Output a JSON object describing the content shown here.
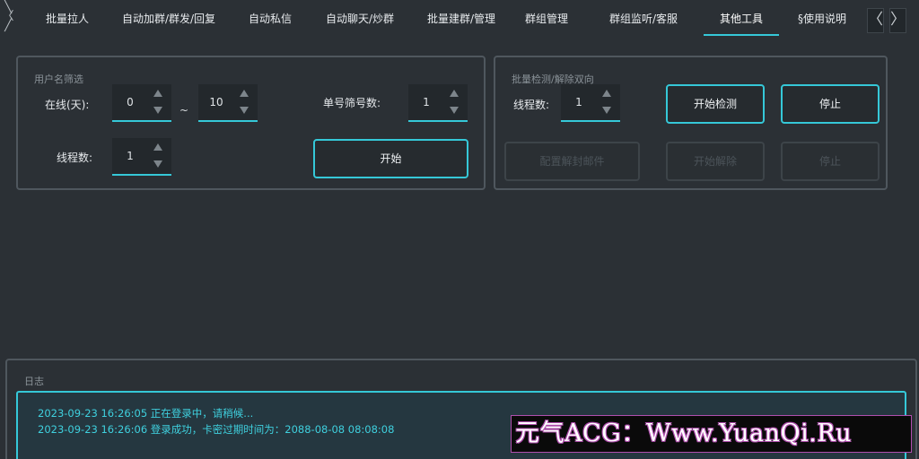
{
  "tabs": [
    {
      "label": "批量拉人",
      "active": false
    },
    {
      "label": "自动加群/群发/回复",
      "active": false
    },
    {
      "label": "自动私信",
      "active": false
    },
    {
      "label": "自动聊天/炒群",
      "active": false
    },
    {
      "label": "批量建群/管理",
      "active": false
    },
    {
      "label": "群组管理",
      "active": false
    },
    {
      "label": "群组监听/客服",
      "active": false
    },
    {
      "label": "其他工具",
      "active": true
    },
    {
      "label": "§使用说明",
      "active": false
    }
  ],
  "tab_nav": {
    "left": "〈",
    "right": "〉",
    "scroll_glyphs": [
      "╲",
      "〈",
      "╱"
    ]
  },
  "filter_group": {
    "title": "用户名筛选",
    "online_label": "在线(天):",
    "online_from": "0",
    "tilde": "~",
    "online_to": "10",
    "single_filter_label": "单号筛号数:",
    "single_filter_value": "1",
    "threads_label": "线程数:",
    "threads_value": "1",
    "start_button": "开始"
  },
  "check_group": {
    "title": "批量检测/解除双向",
    "threads_label": "线程数:",
    "threads_value": "1",
    "start_check_button": "开始检测",
    "stop_button": "停止",
    "config_button": "配置解封邮件",
    "start_unlock_button": "开始解除",
    "stop_unlock_button": "停止"
  },
  "log": {
    "title": "日志",
    "lines": [
      "2023-09-23 16:26:05 正在登录中，请稍候...",
      "2023-09-23 16:26:06 登录成功，卡密过期时间为：2088-08-08 08:08:08"
    ]
  },
  "watermark": "元气ACG：Www.YuanQi.Ru",
  "colors": {
    "accent": "#35c8d8",
    "background": "#2b3035",
    "border": "#4f575e"
  }
}
